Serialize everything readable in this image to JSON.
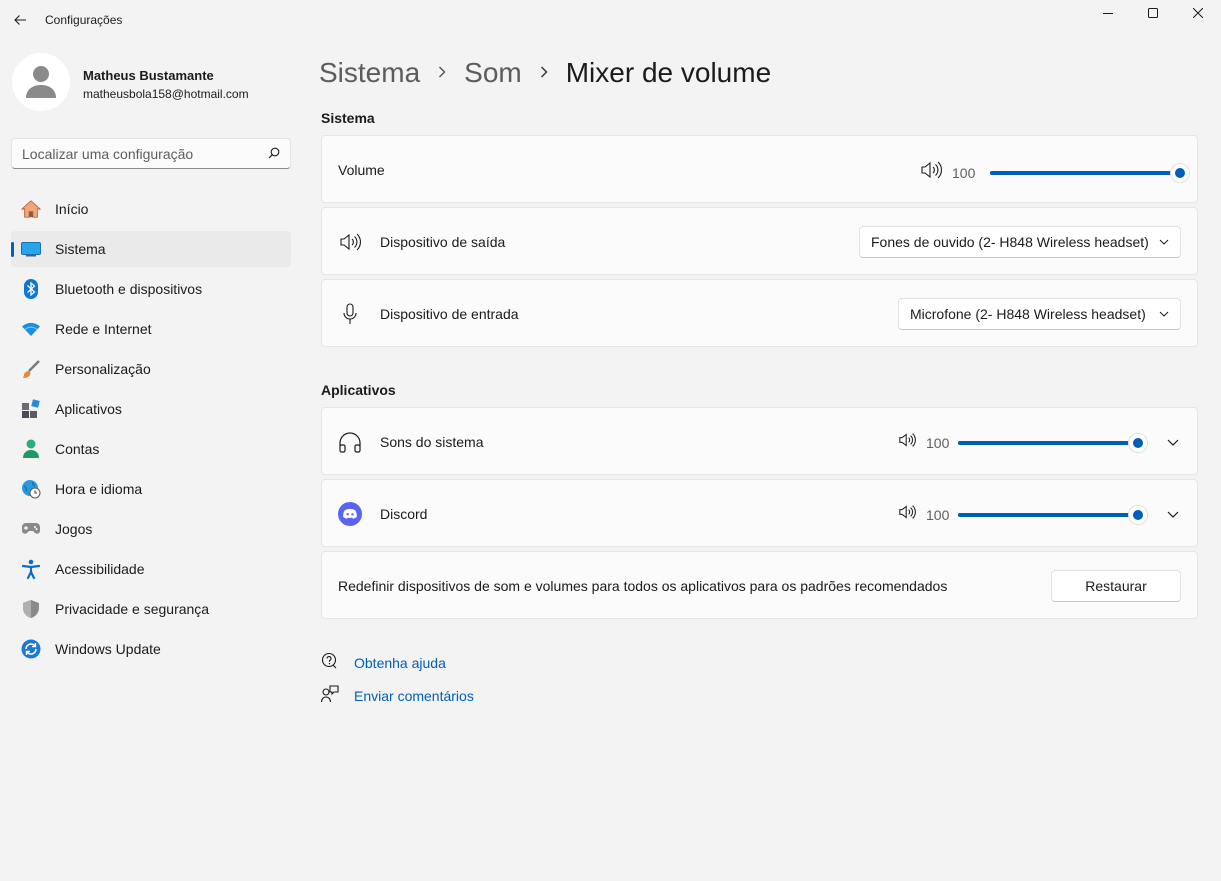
{
  "window": {
    "title": "Configurações"
  },
  "profile": {
    "name": "Matheus Bustamante",
    "email": "matheusbola158@hotmail.com"
  },
  "search": {
    "placeholder": "Localizar uma configuração"
  },
  "nav": {
    "items": [
      {
        "label": "Início",
        "icon": "home-icon"
      },
      {
        "label": "Sistema",
        "icon": "system-icon",
        "active": true
      },
      {
        "label": "Bluetooth e dispositivos",
        "icon": "bluetooth-icon"
      },
      {
        "label": "Rede e Internet",
        "icon": "wifi-icon"
      },
      {
        "label": "Personalização",
        "icon": "brush-icon"
      },
      {
        "label": "Aplicativos",
        "icon": "apps-icon"
      },
      {
        "label": "Contas",
        "icon": "accounts-icon"
      },
      {
        "label": "Hora e idioma",
        "icon": "globe-clock-icon"
      },
      {
        "label": "Jogos",
        "icon": "gamepad-icon"
      },
      {
        "label": "Acessibilidade",
        "icon": "accessibility-icon"
      },
      {
        "label": "Privacidade e segurança",
        "icon": "shield-icon"
      },
      {
        "label": "Windows Update",
        "icon": "update-icon"
      }
    ]
  },
  "breadcrumb": {
    "items": [
      "Sistema",
      "Som"
    ],
    "current": "Mixer de volume"
  },
  "system_section": {
    "title": "Sistema",
    "volume": {
      "label": "Volume",
      "value": "100",
      "level": 1.0
    },
    "output": {
      "label": "Dispositivo de saída",
      "selected": "Fones de ouvido (2- H848 Wireless headset)"
    },
    "input": {
      "label": "Dispositivo de entrada",
      "selected": "Microfone (2- H848 Wireless headset)"
    }
  },
  "apps_section": {
    "title": "Aplicativos",
    "apps": [
      {
        "label": "Sons do sistema",
        "value": "100",
        "level": 1.0,
        "icon": "headphones-icon"
      },
      {
        "label": "Discord",
        "value": "100",
        "level": 1.0,
        "icon": "discord-icon"
      }
    ],
    "reset": {
      "text": "Redefinir dispositivos de som e volumes para todos os aplicativos para os padrões recomendados",
      "button": "Restaurar"
    }
  },
  "links": {
    "help": "Obtenha ajuda",
    "feedback": "Enviar comentários"
  },
  "colors": {
    "accent": "#005fb8",
    "background": "#f3f3f3",
    "card": "#fbfbfb"
  }
}
